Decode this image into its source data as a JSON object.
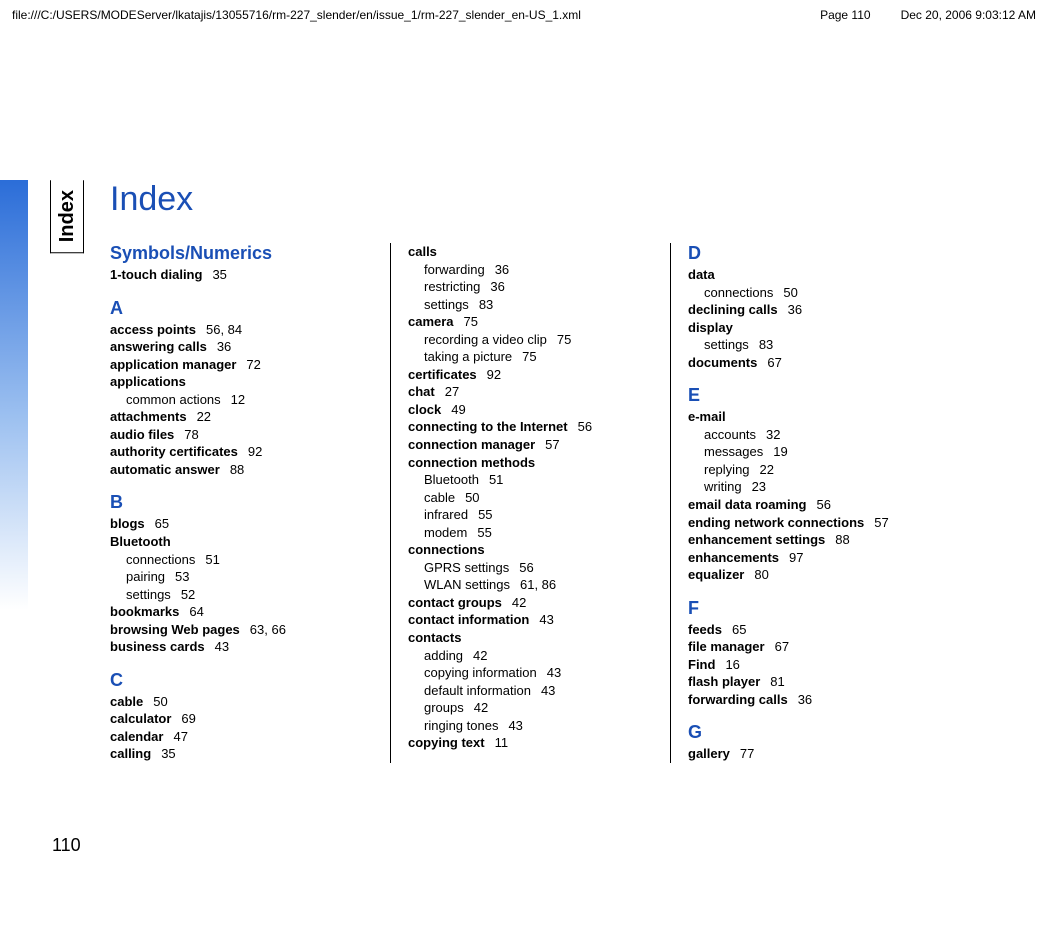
{
  "header": {
    "path": "file:///C:/USERS/MODEServer/lkatajis/13055716/rm-227_slender/en/issue_1/rm-227_slender_en-US_1.xml",
    "page": "Page 110",
    "datetime": "Dec 20, 2006 9:03:12 AM"
  },
  "tab_label": "Index",
  "page_number": "110",
  "title": "Index",
  "columns": [
    [
      {
        "type": "letter",
        "text": "Symbols/Numerics"
      },
      {
        "type": "entry",
        "bold": "1-touch dialing",
        "pg": "35"
      },
      {
        "type": "letter",
        "text": "A"
      },
      {
        "type": "entry",
        "bold": "access points",
        "pg": "56, 84"
      },
      {
        "type": "entry",
        "bold": "answering calls",
        "pg": "36"
      },
      {
        "type": "entry",
        "bold": "application manager",
        "pg": "72"
      },
      {
        "type": "entry",
        "bold": "applications"
      },
      {
        "type": "sub",
        "text": "common actions",
        "pg": "12"
      },
      {
        "type": "entry",
        "bold": "attachments",
        "pg": "22"
      },
      {
        "type": "entry",
        "bold": "audio files",
        "pg": "78"
      },
      {
        "type": "entry",
        "bold": "authority certificates",
        "pg": "92"
      },
      {
        "type": "entry",
        "bold": "automatic answer",
        "pg": "88"
      },
      {
        "type": "letter",
        "text": "B"
      },
      {
        "type": "entry",
        "bold": "blogs",
        "pg": "65"
      },
      {
        "type": "entry",
        "bold": "Bluetooth"
      },
      {
        "type": "sub",
        "text": "connections",
        "pg": "51"
      },
      {
        "type": "sub",
        "text": "pairing",
        "pg": "53"
      },
      {
        "type": "sub",
        "text": "settings",
        "pg": "52"
      },
      {
        "type": "entry",
        "bold": "bookmarks",
        "pg": "64"
      },
      {
        "type": "entry",
        "bold": "browsing Web pages",
        "pg": "63, 66"
      },
      {
        "type": "entry",
        "bold": "business cards",
        "pg": "43"
      },
      {
        "type": "letter",
        "text": "C"
      },
      {
        "type": "entry",
        "bold": "cable",
        "pg": "50"
      },
      {
        "type": "entry",
        "bold": "calculator",
        "pg": "69"
      },
      {
        "type": "entry",
        "bold": "calendar",
        "pg": "47"
      },
      {
        "type": "entry",
        "bold": "calling",
        "pg": "35"
      }
    ],
    [
      {
        "type": "entry",
        "bold": "calls"
      },
      {
        "type": "sub",
        "text": "forwarding",
        "pg": "36"
      },
      {
        "type": "sub",
        "text": "restricting",
        "pg": "36"
      },
      {
        "type": "sub",
        "text": "settings",
        "pg": "83"
      },
      {
        "type": "entry",
        "bold": "camera",
        "pg": "75"
      },
      {
        "type": "sub",
        "text": "recording a video clip",
        "pg": "75"
      },
      {
        "type": "sub",
        "text": "taking a picture",
        "pg": "75"
      },
      {
        "type": "entry",
        "bold": "certificates",
        "pg": "92"
      },
      {
        "type": "entry",
        "bold": "chat",
        "pg": "27"
      },
      {
        "type": "entry",
        "bold": "clock",
        "pg": "49"
      },
      {
        "type": "entry",
        "bold": "connecting to the Internet",
        "pg": "56"
      },
      {
        "type": "entry",
        "bold": "connection manager",
        "pg": "57"
      },
      {
        "type": "entry",
        "bold": "connection methods"
      },
      {
        "type": "sub",
        "text": "Bluetooth",
        "pg": "51"
      },
      {
        "type": "sub",
        "text": "cable",
        "pg": "50"
      },
      {
        "type": "sub",
        "text": "infrared",
        "pg": "55"
      },
      {
        "type": "sub",
        "text": "modem",
        "pg": "55"
      },
      {
        "type": "entry",
        "bold": "connections"
      },
      {
        "type": "sub",
        "text": "GPRS settings",
        "pg": "56"
      },
      {
        "type": "sub",
        "text": "WLAN settings",
        "pg": "61, 86"
      },
      {
        "type": "entry",
        "bold": "contact groups",
        "pg": "42"
      },
      {
        "type": "entry",
        "bold": "contact information",
        "pg": "43"
      },
      {
        "type": "entry",
        "bold": "contacts"
      },
      {
        "type": "sub",
        "text": "adding",
        "pg": "42"
      },
      {
        "type": "sub",
        "text": "copying information",
        "pg": "43"
      },
      {
        "type": "sub",
        "text": "default information",
        "pg": "43"
      },
      {
        "type": "sub",
        "text": "groups",
        "pg": "42"
      },
      {
        "type": "sub",
        "text": "ringing tones",
        "pg": "43"
      },
      {
        "type": "entry",
        "bold": "copying text",
        "pg": "11"
      }
    ],
    [
      {
        "type": "letter",
        "text": "D"
      },
      {
        "type": "entry",
        "bold": "data"
      },
      {
        "type": "sub",
        "text": "connections",
        "pg": "50"
      },
      {
        "type": "entry",
        "bold": "declining calls",
        "pg": "36"
      },
      {
        "type": "entry",
        "bold": "display"
      },
      {
        "type": "sub",
        "text": "settings",
        "pg": "83"
      },
      {
        "type": "entry",
        "bold": "documents",
        "pg": "67"
      },
      {
        "type": "letter",
        "text": "E"
      },
      {
        "type": "entry",
        "bold": "e-mail"
      },
      {
        "type": "sub",
        "text": "accounts",
        "pg": "32"
      },
      {
        "type": "sub",
        "text": "messages",
        "pg": "19"
      },
      {
        "type": "sub",
        "text": "replying",
        "pg": "22"
      },
      {
        "type": "sub",
        "text": "writing",
        "pg": "23"
      },
      {
        "type": "entry",
        "bold": "email data roaming",
        "pg": "56"
      },
      {
        "type": "entry",
        "bold": "ending network connections",
        "pg": "57"
      },
      {
        "type": "entry",
        "bold": "enhancement settings",
        "pg": "88"
      },
      {
        "type": "entry",
        "bold": "enhancements",
        "pg": "97"
      },
      {
        "type": "entry",
        "bold": "equalizer",
        "pg": "80"
      },
      {
        "type": "letter",
        "text": "F"
      },
      {
        "type": "entry",
        "bold": "feeds",
        "pg": "65"
      },
      {
        "type": "entry",
        "bold": "file manager",
        "pg": "67"
      },
      {
        "type": "entry",
        "bold": "Find",
        "pg": "16"
      },
      {
        "type": "entry",
        "bold": "flash player",
        "pg": "81"
      },
      {
        "type": "entry",
        "bold": "forwarding calls",
        "pg": "36"
      },
      {
        "type": "letter",
        "text": "G"
      },
      {
        "type": "entry",
        "bold": "gallery",
        "pg": "77"
      }
    ]
  ]
}
